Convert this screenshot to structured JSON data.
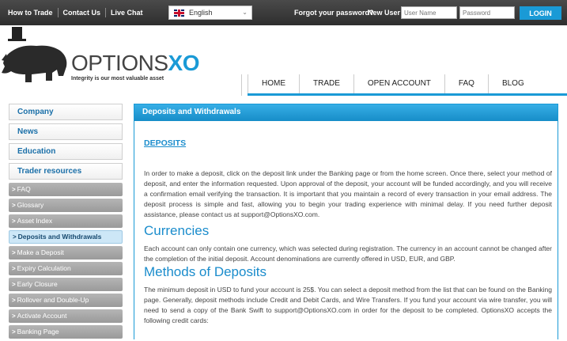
{
  "topbar": {
    "links": [
      "How to Trade",
      "Contact Us",
      "Live Chat"
    ],
    "language": "English",
    "forgot_password": "Forgot your password?",
    "new_user": "New User",
    "username_placeholder": "User Name",
    "password_placeholder": "Password",
    "login_label": "LOGIN"
  },
  "brand": {
    "name_part1": "OPTIONS",
    "name_part2": "XO",
    "tagline": "Integrity is our most valuable asset"
  },
  "nav": [
    "HOME",
    "TRADE",
    "OPEN ACCOUNT",
    "FAQ",
    "BLOG"
  ],
  "sidebar": {
    "main": [
      "Company",
      "News",
      "Education",
      "Trader resources"
    ],
    "sub": [
      "FAQ",
      "Glossary",
      "Asset Index",
      "Deposits and Withdrawals",
      "Make a Deposit",
      "Expiry Calculation",
      "Early Closure",
      "Rollover and Double-Up",
      "Activate Account",
      "Banking Page"
    ],
    "active": "Deposits and Withdrawals"
  },
  "content": {
    "title": "Deposits and Withdrawals",
    "deposits_heading": "DEPOSITS",
    "deposits_text": "In order to make a deposit, click on the deposit link under the Banking page or from the home screen. Once there, select your method of deposit, and enter the information requested. Upon approval of the deposit, your account will be funded accordingly, and you will receive a confirmation email verifying the transaction. It is important that you maintain a record of every transaction in your email address. The deposit process is simple and fast, allowing you to begin your trading experience with minimal delay. If you need further deposit assistance, please contact us at support@OptionsXO.com.",
    "currencies_heading": "Currencies",
    "currencies_text": "Each account can only contain one currency, which was selected during registration. The currency in an account cannot be changed after the completion of the initial deposit. Account denominations are currently offered in USD, EUR, and GBP.",
    "methods_heading": "Methods of Deposits",
    "methods_text": "The minimum deposit in USD to fund your account is 25$. You can select a deposit method from the list that can be found on the Banking page. Generally, deposit methods include Credit and Debit Cards, and Wire Transfers. If you fund your account via wire transfer, you will need to send a copy of the Bank Swift to support@OptionsXO.com in order for the deposit to be completed. OptionsXO accepts the following credit cards:"
  },
  "colors": {
    "accent": "#1a9ad6",
    "topbar": "#3a3a3a",
    "link": "#1a8ccc"
  }
}
